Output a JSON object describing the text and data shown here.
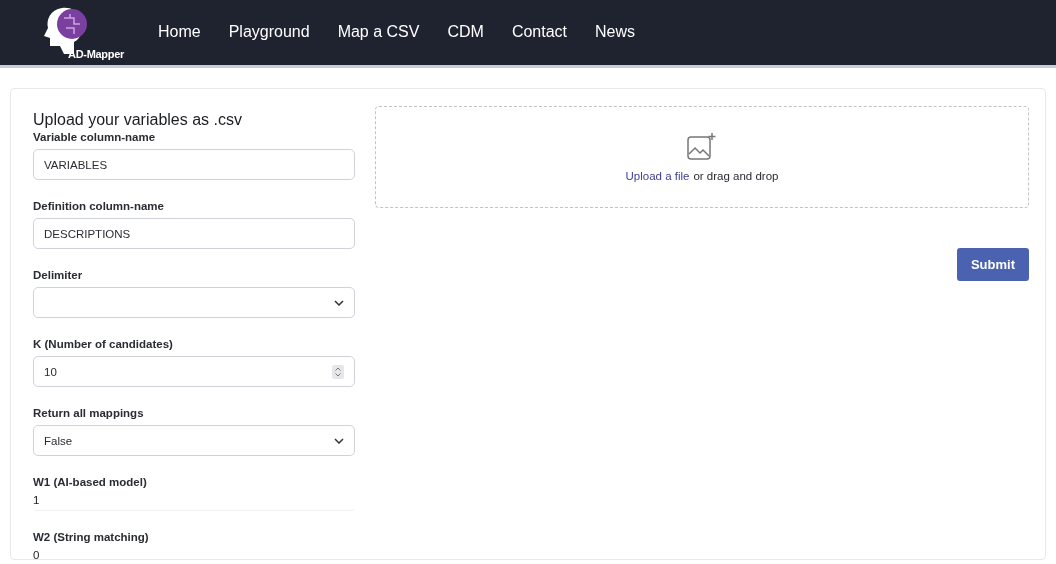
{
  "nav": {
    "logo_text": "AD-Mapper",
    "links": [
      "Home",
      "Playground",
      "Map a CSV",
      "CDM",
      "Contact",
      "News"
    ]
  },
  "form": {
    "title": "Upload your variables as .csv",
    "fields": [
      {
        "label": "Variable column-name",
        "kind": "text",
        "value": "VARIABLES"
      },
      {
        "label": "Definition column-name",
        "kind": "text",
        "value": "DESCRIPTIONS"
      },
      {
        "label": "Delimiter",
        "kind": "select"
      },
      {
        "label": "K (Number of candidates)",
        "kind": "number",
        "value": "10"
      },
      {
        "label": "Return all mappings",
        "kind": "select",
        "value": "False"
      },
      {
        "label": "W1 (AI-based model)",
        "kind": "plain",
        "value": "1"
      },
      {
        "label": "W2 (String matching)",
        "kind": "plain",
        "value": "0"
      }
    ]
  },
  "upload": {
    "link": "Upload a file",
    "text": "or drag and drop"
  },
  "submit": "Submit"
}
